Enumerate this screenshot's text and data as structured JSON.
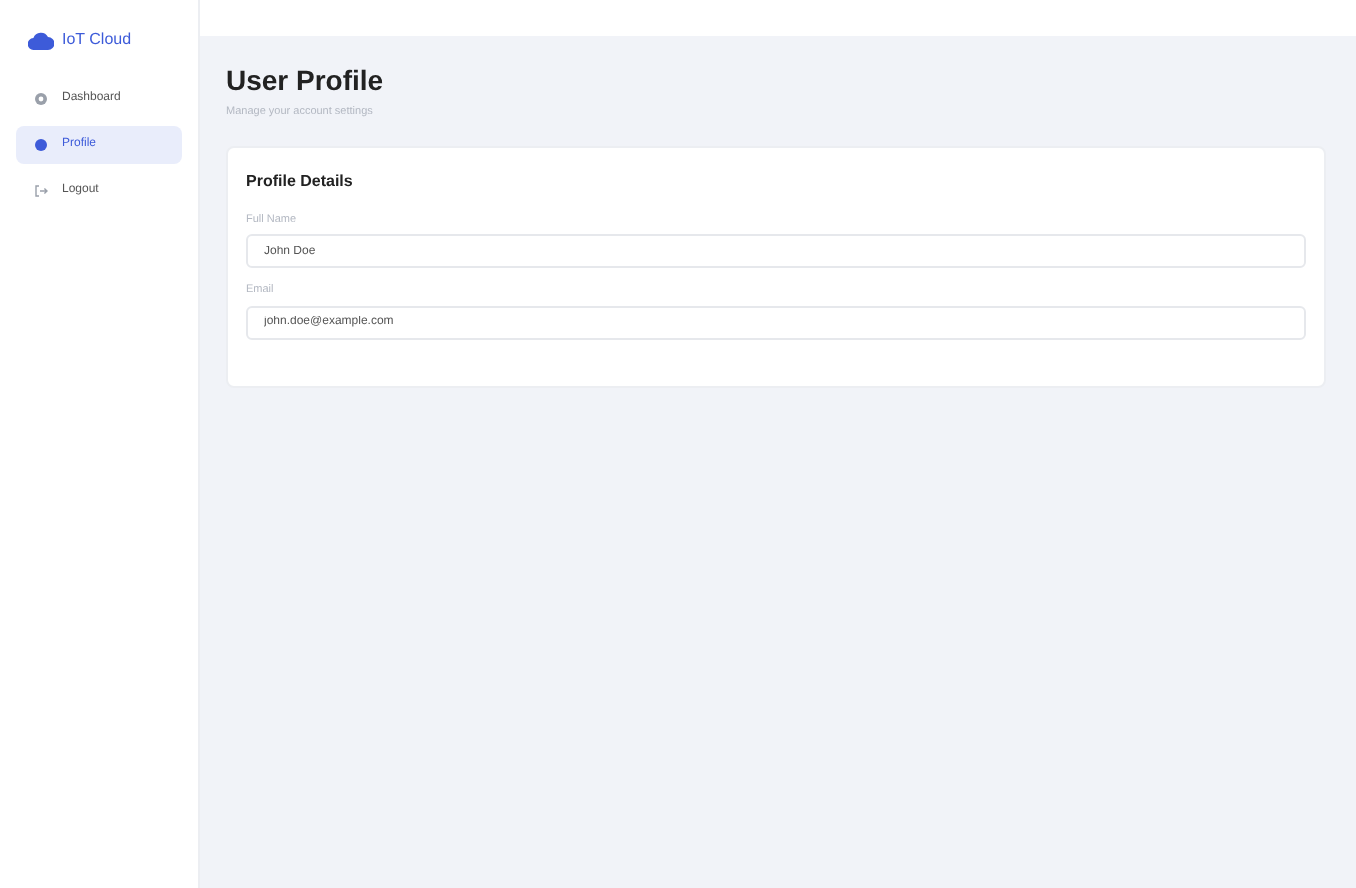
{
  "brand": {
    "name": "IoT Cloud"
  },
  "sidebar": {
    "items": [
      {
        "label": "Dashboard",
        "kind": "dashboard",
        "selected": false
      },
      {
        "label": "Profile",
        "kind": "profile",
        "selected": true
      },
      {
        "label": "Logout",
        "kind": "logout",
        "selected": false
      }
    ]
  },
  "page": {
    "title": "User Profile",
    "subtitle": "Manage your account settings"
  },
  "card": {
    "title": "Profile Details",
    "fields": [
      {
        "label": "Full Name",
        "value": "John Doe"
      },
      {
        "label": "Email",
        "value": "john.doe@example.com"
      }
    ]
  }
}
